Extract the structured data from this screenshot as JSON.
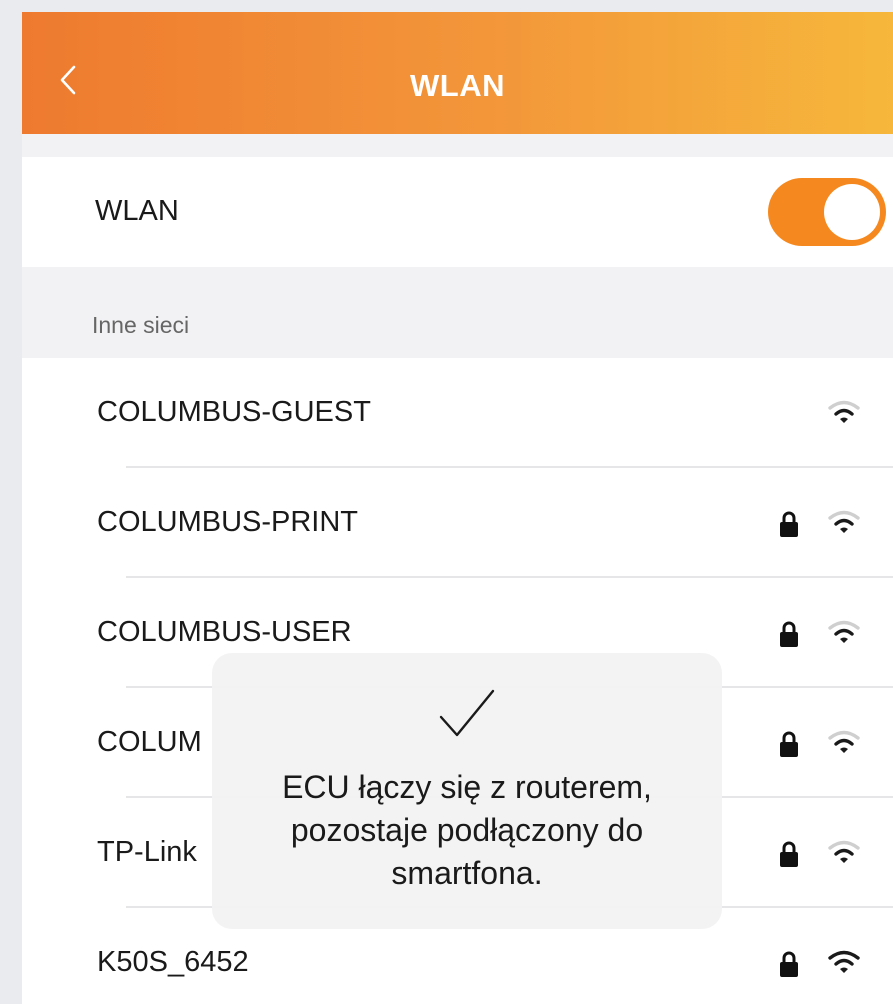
{
  "header": {
    "title": "WLAN",
    "back_icon": "chevron-left-icon"
  },
  "wlan_toggle": {
    "label": "WLAN",
    "on": true,
    "accent_color": "#f5891f"
  },
  "section": {
    "label": "Inne sieci"
  },
  "networks": [
    {
      "name": "COLUMBUS-GUEST",
      "locked": false,
      "signal": "medium"
    },
    {
      "name": "COLUMBUS-PRINT",
      "locked": true,
      "signal": "medium"
    },
    {
      "name": "COLUMBUS-USER",
      "locked": true,
      "signal": "medium"
    },
    {
      "name": "COLUM",
      "locked": true,
      "signal": "medium"
    },
    {
      "name": "TP-Link",
      "locked": true,
      "signal": "medium"
    },
    {
      "name": "K50S_6452",
      "locked": true,
      "signal": "full"
    }
  ],
  "toast": {
    "icon": "checkmark-icon",
    "line1": "ECU łączy się z routerem,",
    "line2": "pozostaje podłączony do",
    "line3": "smartfona."
  }
}
